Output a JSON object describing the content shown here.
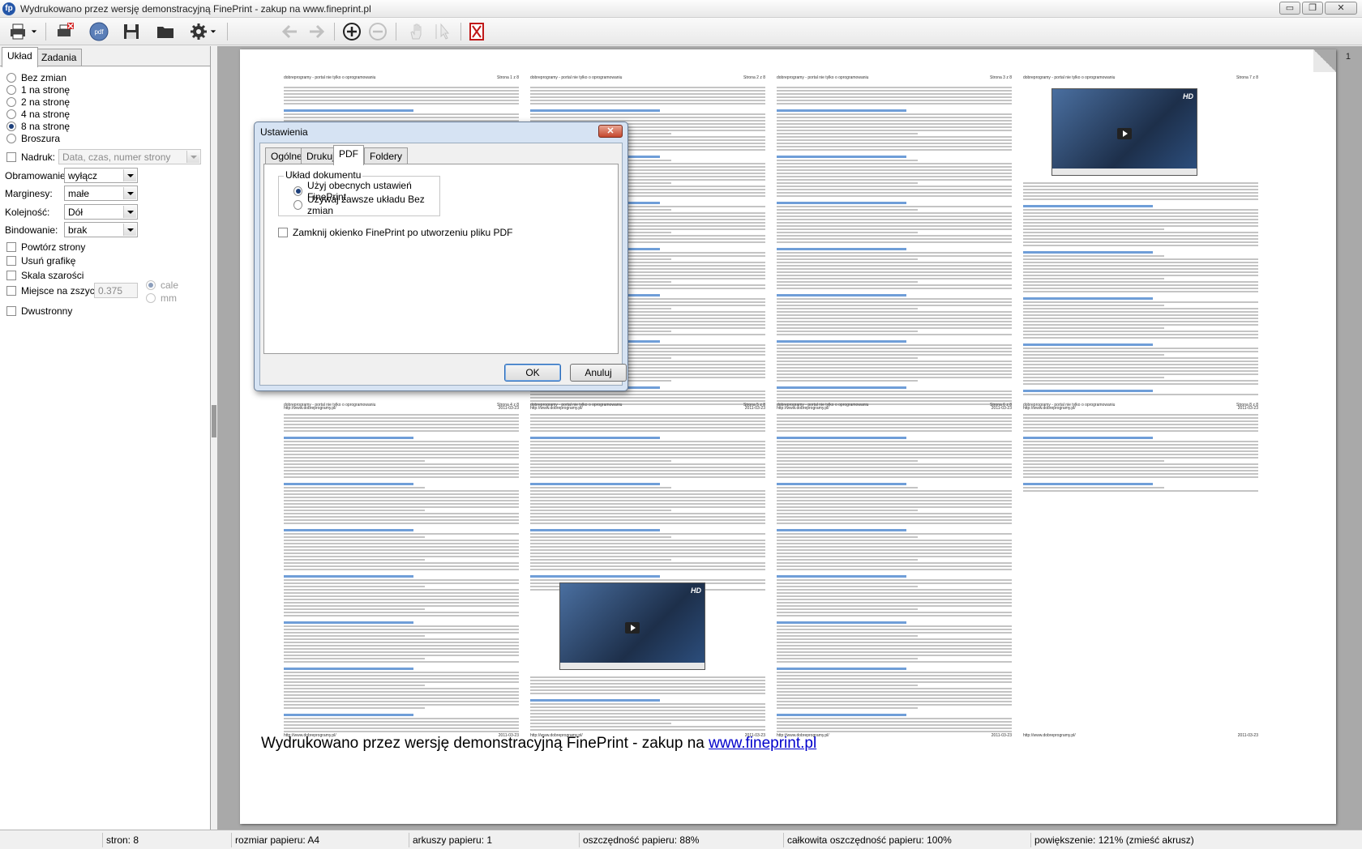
{
  "window": {
    "title": "Wydrukowano przez wersję demonstracyjną FinePrint - zakup na www.fineprint.pl",
    "app_icon_letter": "fp",
    "controls": {
      "minimize": "▭",
      "maximize": "❐",
      "close": "✕"
    }
  },
  "toolbar": {
    "buttons": [
      "print-icon",
      "print-delete-icon",
      "pdf-icon",
      "save-icon",
      "folder-icon",
      "gear-icon",
      "back-arrow-icon",
      "forward-arrow-icon",
      "zoom-in-icon",
      "zoom-out-icon",
      "hand-icon",
      "select-cursor-icon",
      "delete-job-icon"
    ],
    "pdf_label": "pdf"
  },
  "left_panel": {
    "tabs": [
      "Układ",
      "Zadania"
    ],
    "active_tab": "Układ",
    "layout_options": [
      "Bez zmian",
      "1 na stronę",
      "2 na stronę",
      "4 na stronę",
      "8 na stronę",
      "Broszura"
    ],
    "selected_layout": "8 na stronę",
    "nadruk": {
      "label": "Nadruk:",
      "value": "Data, czas, numer strony",
      "checked": false
    },
    "obramowanie": {
      "label": "Obramowanie:",
      "value": "wyłącz"
    },
    "marginesy": {
      "label": "Marginesy:",
      "value": "małe"
    },
    "kolejnosc": {
      "label": "Kolejność:",
      "value": "Dół"
    },
    "bindowanie": {
      "label": "Bindowanie:",
      "value": "brak"
    },
    "checkboxes": [
      "Powtórz strony",
      "Usuń grafikę",
      "Skala szarości"
    ],
    "miejsce": {
      "label": "Miejsce na zszycie",
      "value": "0.375",
      "unit_options": [
        "cale",
        "mm"
      ]
    },
    "duplex": "Dwustronny"
  },
  "preview": {
    "page_number": "1",
    "minipages": [
      {
        "head_left": "dobreprogramy - portal nie tylko o oprogramowaniu",
        "head_right": "Strona 1 z 8",
        "foot_left": "http://www.dobreprogramy.pl/",
        "foot_right": "2011-03-23"
      },
      {
        "head_left": "dobreprogramy - portal nie tylko o oprogramowaniu",
        "head_right": "Strona 2 z 8",
        "foot_left": "http://www.dobreprogramy.pl/",
        "foot_right": "2011-03-23"
      },
      {
        "head_left": "dobreprogramy - portal nie tylko o oprogramowaniu",
        "head_right": "Strona 3 z 8",
        "foot_left": "http://www.dobreprogramy.pl/",
        "foot_right": "2011-03-23"
      },
      {
        "head_left": "dobreprogramy - portal nie tylko o oprogramowaniu",
        "head_right": "Strona 7 z 8",
        "foot_left": "http://www.dobreprogramy.pl/",
        "foot_right": "2011-03-23"
      },
      {
        "head_left": "dobreprogramy - portal nie tylko o oprogramowaniu",
        "head_right": "Strona 4 z 8",
        "foot_left": "http://www.dobreprogramy.pl/",
        "foot_right": "2011-03-23"
      },
      {
        "head_left": "dobreprogramy - portal nie tylko o oprogramowaniu",
        "head_right": "Strona 5 z 8",
        "foot_left": "http://www.dobreprogramy.pl/",
        "foot_right": "2011-03-23"
      },
      {
        "head_left": "dobreprogramy - portal nie tylko o oprogramowaniu",
        "head_right": "Strona 6 z 8",
        "foot_left": "http://www.dobreprogramy.pl/",
        "foot_right": "2011-03-23"
      },
      {
        "head_left": "dobreprogramy - portal nie tylko o oprogramowaniu",
        "head_right": "Strona 8 z 8",
        "foot_left": "http://www.dobreprogramy.pl/",
        "foot_right": "2011-03-23"
      }
    ],
    "watermark_text": "Wydrukowano przez wersję demonstracyjną FinePrint - zakup na ",
    "watermark_link": "www.fineprint.pl",
    "video_badge": "HD"
  },
  "dialog": {
    "title": "Ustawienia",
    "close": "✕",
    "tabs": [
      "Ogólne",
      "Drukuj",
      "PDF",
      "Foldery"
    ],
    "active_tab": "PDF",
    "group_label": "Układ dokumentu",
    "radio_options": [
      "Użyj obecnych ustawień FinePrint",
      "Używaj zawsze układu Bez zmian"
    ],
    "selected_option": "Użyj obecnych ustawień FinePrint",
    "checkbox_label": "Zamknij okienko FinePrint po utworzeniu pliku PDF",
    "ok_label": "OK",
    "cancel_label": "Anuluj"
  },
  "status_bar": {
    "pages": "stron: 8",
    "paper_size": "rozmiar papieru: A4",
    "sheets": "arkuszy papieru: 1",
    "saving": "oszczędność papieru: 88%",
    "total_saving": "całkowita oszczędność papieru: 100%",
    "zoom": "powiększenie: 121% (zmieść akrusz)"
  }
}
